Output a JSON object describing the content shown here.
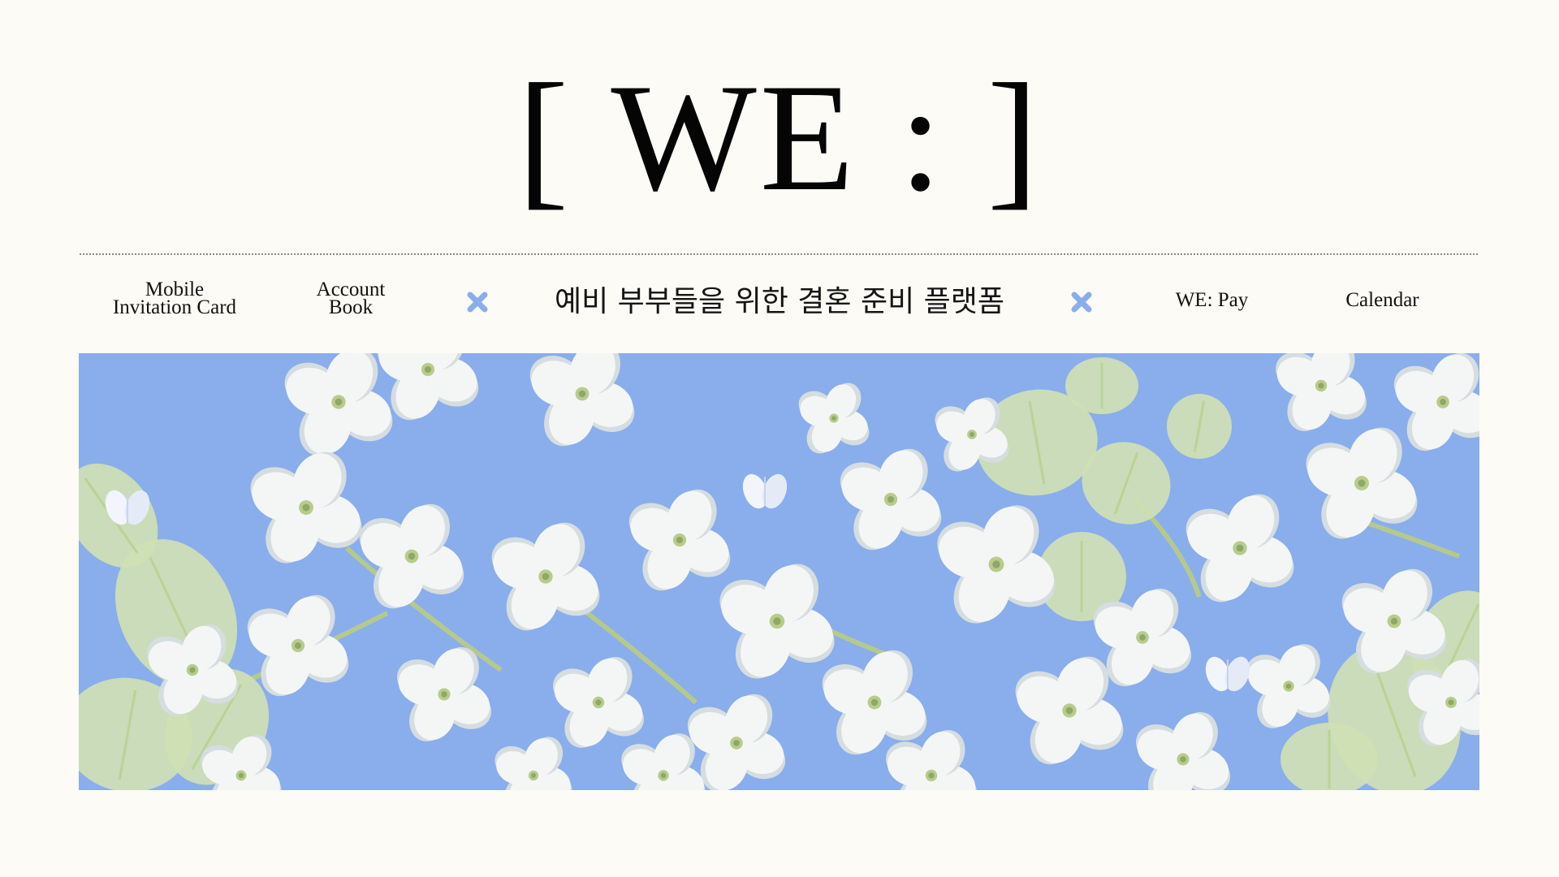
{
  "header": {
    "logo": "[ WE : ]"
  },
  "nav": {
    "mobile_invitation": [
      "Mobile",
      "Invitation Card"
    ],
    "account_book": [
      "Account",
      "Book"
    ],
    "tagline": "예비 부부들을 위한 결혼 준비 플랫폼",
    "we_pay": "WE: Pay",
    "calendar": "Calendar"
  },
  "icons": {
    "separator": "x-icon",
    "separator_color": "#8aadec"
  },
  "colors": {
    "background": "#fdfbf6",
    "hero_sky": "#8aadec",
    "petal": "#f4f6f5",
    "petal_shade": "#d5dde0",
    "leaf": "#cfe0b4",
    "leaf_dark": "#b9d394",
    "text": "#111111"
  },
  "hero": {
    "image": "blue-sky-white-hydrangea-illustration"
  }
}
